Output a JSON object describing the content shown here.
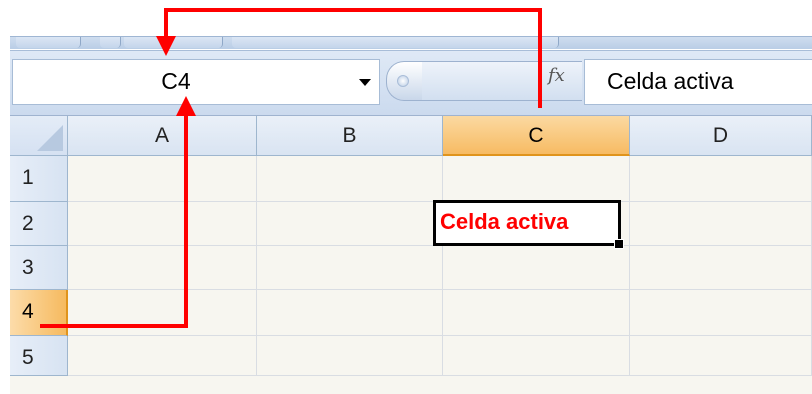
{
  "name_box": {
    "value": "C4"
  },
  "formula_bar": {
    "fx_label": "fx",
    "content": "Celda activa"
  },
  "columns": [
    {
      "label": "A",
      "active": false
    },
    {
      "label": "B",
      "active": false
    },
    {
      "label": "C",
      "active": true
    },
    {
      "label": "D",
      "active": false
    }
  ],
  "rows": [
    {
      "label": "1",
      "active": false
    },
    {
      "label": "2",
      "active": false
    },
    {
      "label": "3",
      "active": false
    },
    {
      "label": "4",
      "active": true
    },
    {
      "label": "5",
      "active": false
    }
  ],
  "active_cell": {
    "text": "Celda activa"
  },
  "colors": {
    "annotation_arrow": "#ff0000",
    "active_header": "#f7bb63",
    "active_cell_text": "#ff0000"
  }
}
